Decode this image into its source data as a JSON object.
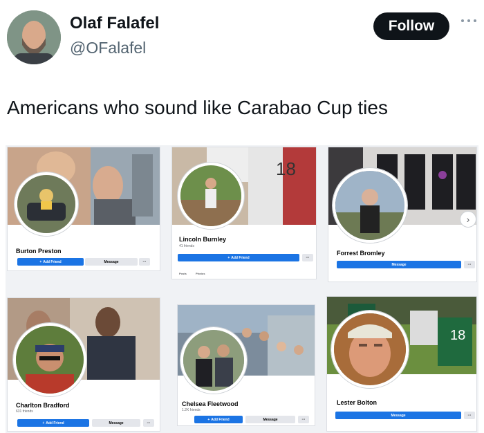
{
  "tweet": {
    "author_name": "Olaf Falafel",
    "author_handle": "@OFalafel",
    "follow_label": "Follow",
    "more_icon": "more-horizontal-icon",
    "text": "Americans who sound like Carabao Cup ties"
  },
  "cards": [
    {
      "name": "Burton Preston",
      "friends": "",
      "primary_label": "Add Friend",
      "secondary_label": "Message",
      "more_label": "···"
    },
    {
      "name": "Lincoln Burnley",
      "friends": "41 friends",
      "primary_label": "Add Friend",
      "secondary_label": "",
      "more_label": "···",
      "tabs": [
        "Posts",
        "Photos"
      ]
    },
    {
      "name": "Forrest Bromley",
      "friends": "",
      "primary_label": "Message",
      "secondary_label": "",
      "more_label": "···"
    },
    {
      "name": "Charlton Bradford",
      "friends": "631 friends",
      "primary_label": "Add Friend",
      "secondary_label": "Message",
      "more_label": "···"
    },
    {
      "name": "Chelsea Fleetwood",
      "friends": "1.2K friends",
      "primary_label": "Add Friend",
      "secondary_label": "Message",
      "more_label": "···"
    },
    {
      "name": "Lester Bolton",
      "friends": "",
      "primary_label": "Message",
      "secondary_label": "",
      "more_label": "···"
    }
  ],
  "colors": {
    "fb_blue": "#1b74e4",
    "follow_bg": "#0f1419",
    "handle_gray": "#536471"
  }
}
